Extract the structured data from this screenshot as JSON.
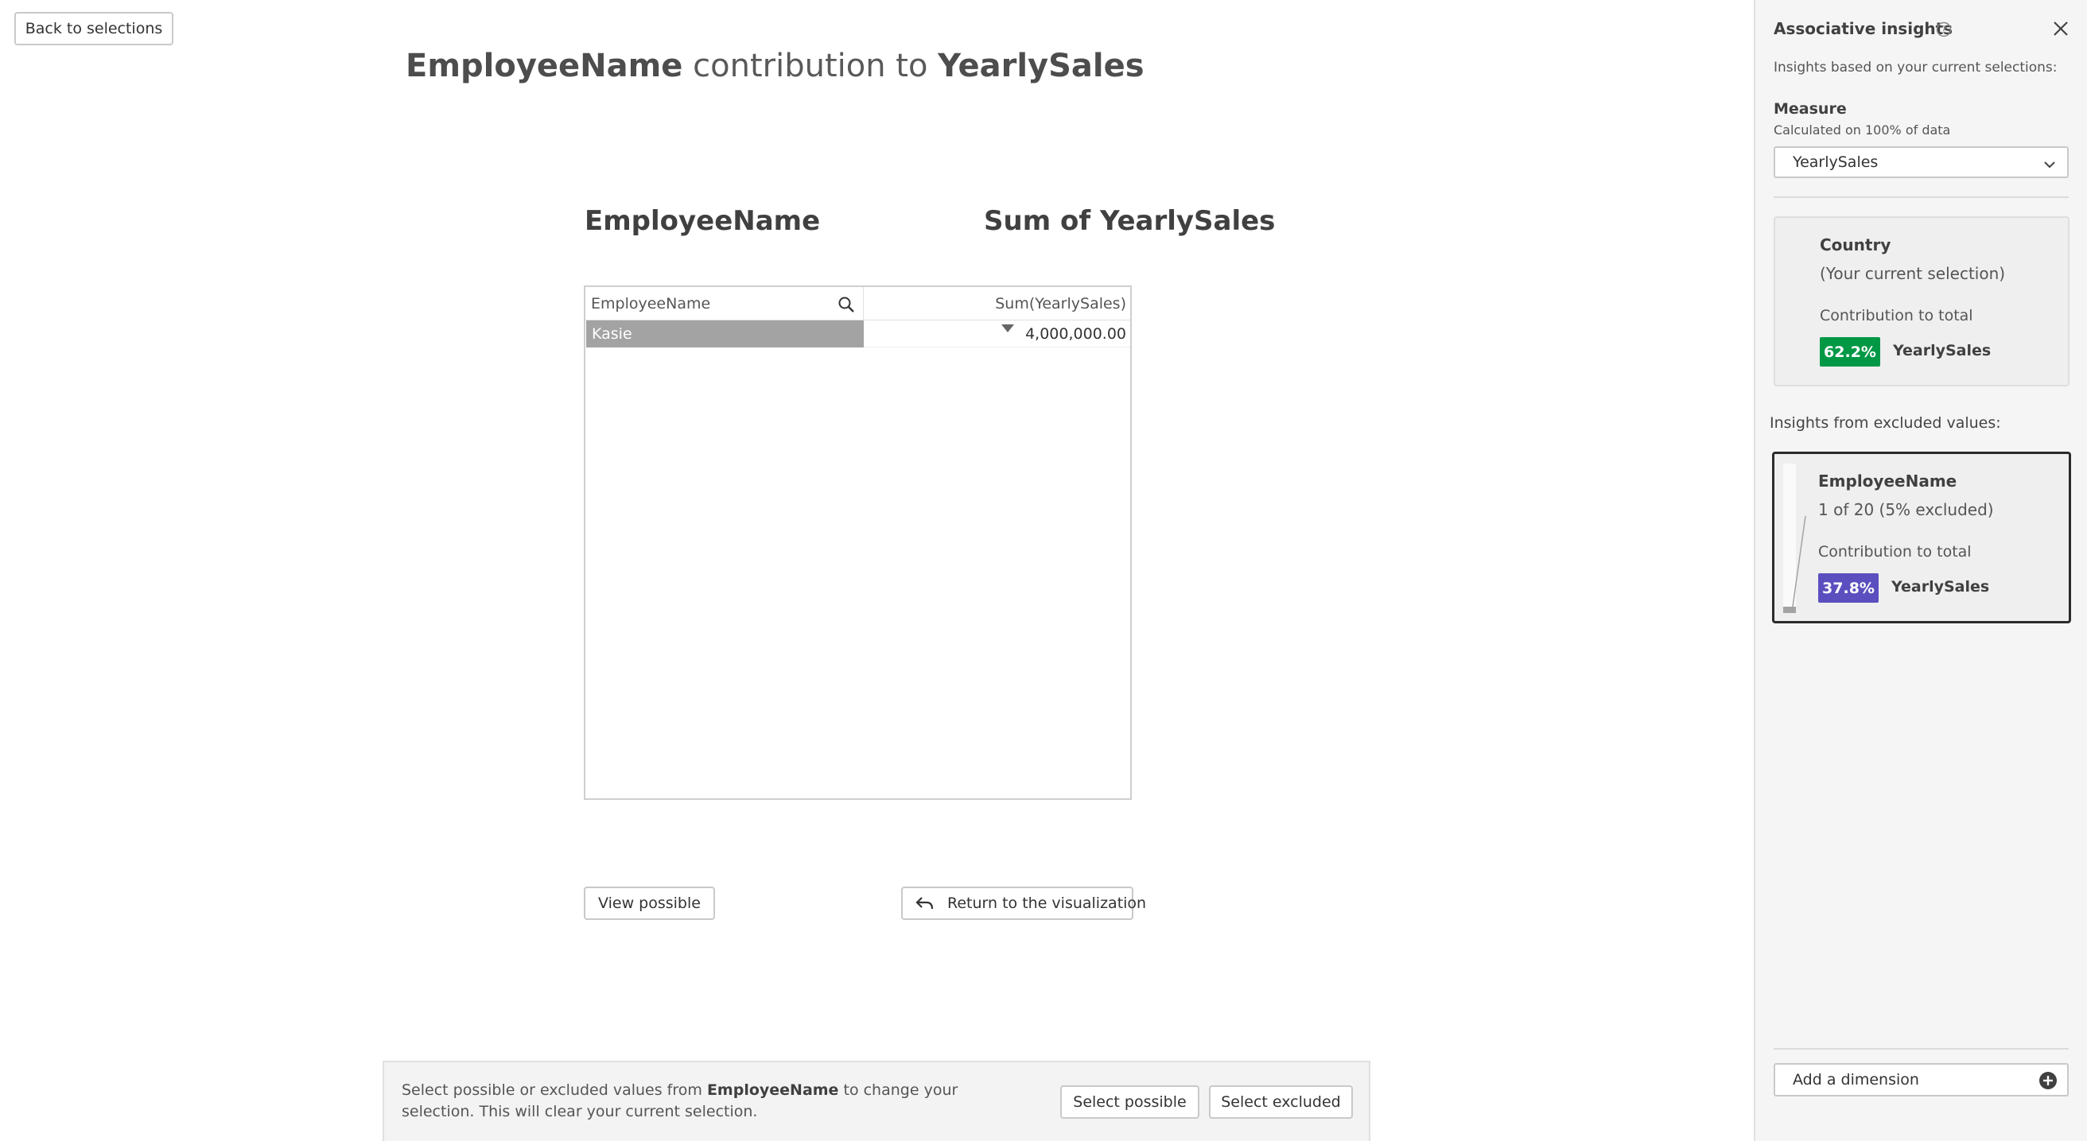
{
  "header": {
    "back_label": "Back to selections"
  },
  "headline": {
    "dimension": "EmployeeName",
    "middle": " contribution to ",
    "measure": "YearlySales"
  },
  "table": {
    "dimension_title": "EmployeeName",
    "measure_title": "Sum of YearlySales",
    "columns": [
      "EmployeeName",
      "Sum(YearlySales)"
    ],
    "rows": [
      {
        "name": "Kasie",
        "value": "4,000,000.00"
      }
    ]
  },
  "actions": {
    "view_possible": "View possible",
    "return_label": "Return to the visualization"
  },
  "bottom_bar": {
    "text_before": "Select possible or excluded values from ",
    "field": "EmployeeName",
    "text_after": " to change your selection. This will clear your current selection.",
    "select_possible": "Select possible",
    "select_excluded": "Select excluded"
  },
  "panel": {
    "title": "Associative insights",
    "subtitle": "Insights based on your current selections:",
    "measure_label": "Measure",
    "measure_note": "Calculated on 100% of data",
    "measure_value": "YearlySales",
    "current_card": {
      "field": "Country",
      "note": "(Your current selection)",
      "contribution_label": "Contribution to total",
      "badge": "62.2%",
      "badge_color": "#009845",
      "measure": "YearlySales"
    },
    "excluded_heading": "Insights from excluded values:",
    "excluded_card": {
      "field": "EmployeeName",
      "note": "1 of 20 (5% excluded)",
      "contribution_label": "Contribution to total",
      "badge": "37.8%",
      "badge_color": "#5b4fbf",
      "measure": "YearlySales"
    },
    "add_dimension": "Add a dimension"
  },
  "icons": {
    "search": "search-icon",
    "help": "help-icon",
    "close": "close-icon",
    "chevron": "chevron-down-icon",
    "return": "return-arrow-icon",
    "add": "plus-circle-icon",
    "sort": "sort-descending-icon"
  },
  "colors": {
    "selected_row": "#a3a3a3",
    "positive_badge": "#009845",
    "excluded_badge": "#5b4fbf"
  }
}
